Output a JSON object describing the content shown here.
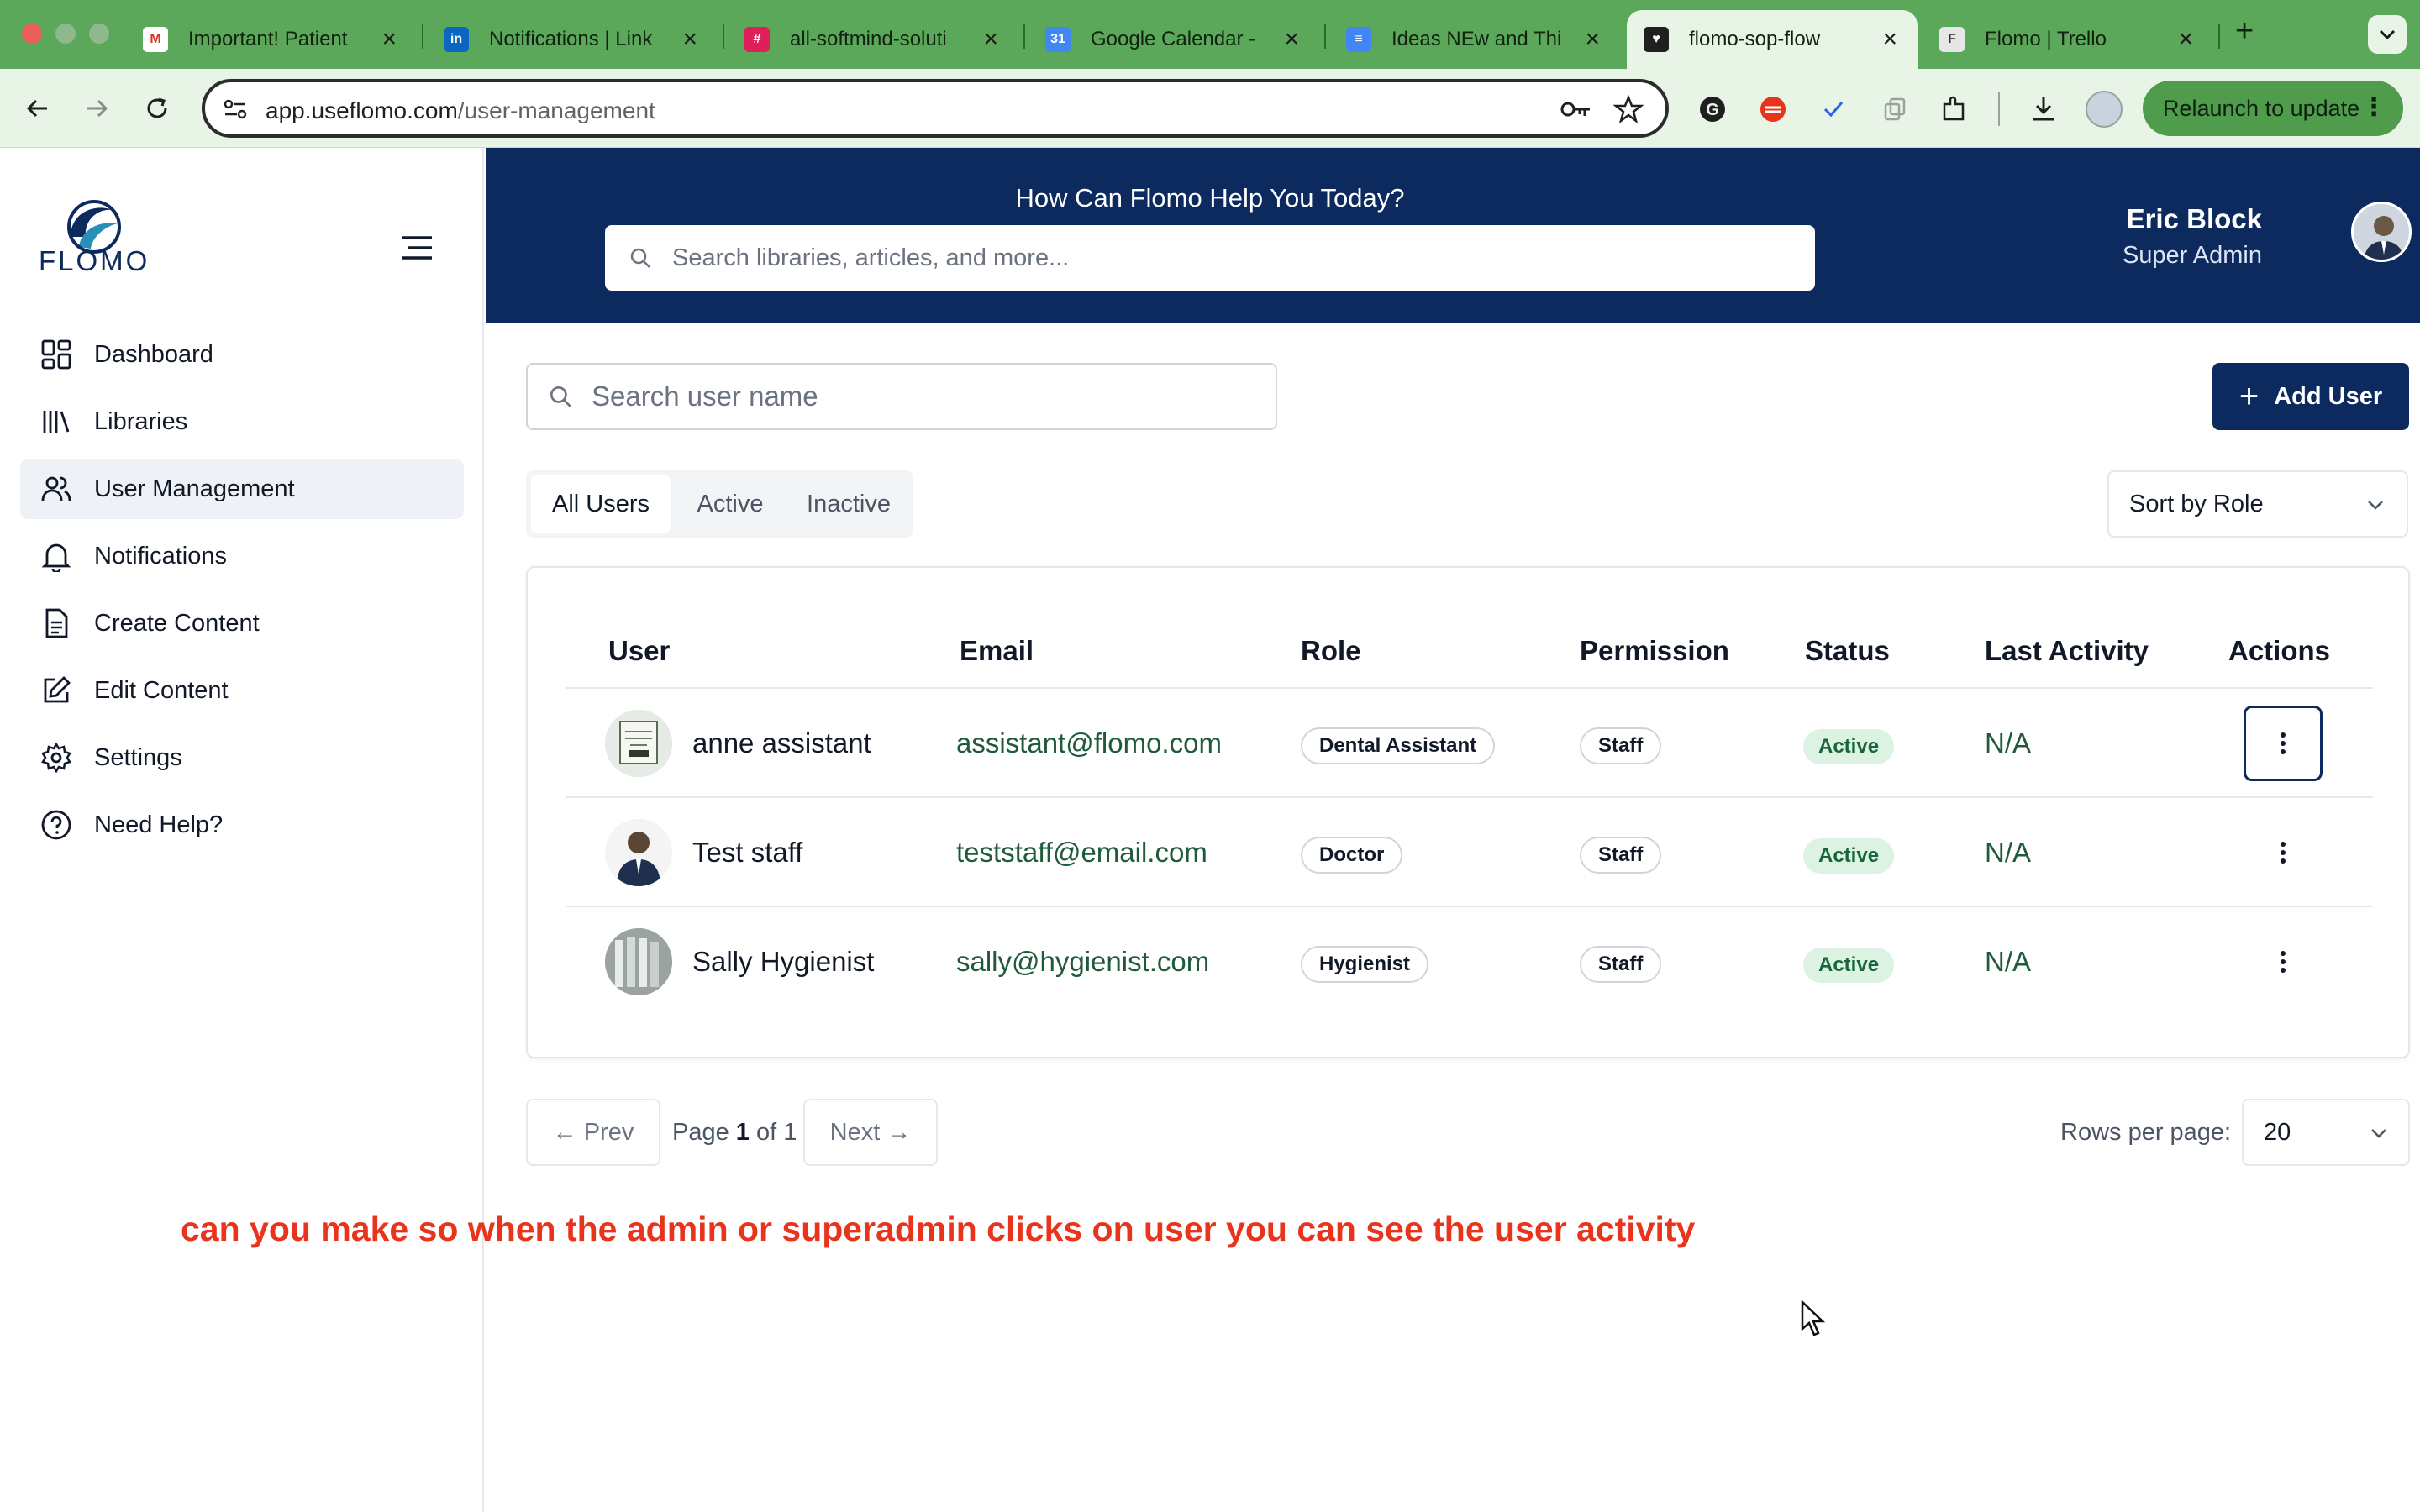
{
  "browser": {
    "tabs": [
      {
        "title": "Important! Patient",
        "favicon": "gmail-icon"
      },
      {
        "title": "Notifications | Link",
        "favicon": "linkedin-icon"
      },
      {
        "title": "all-softmind-soluti",
        "favicon": "slack-icon"
      },
      {
        "title": "Google Calendar -",
        "favicon": "calendar-icon"
      },
      {
        "title": "Ideas NEw and Thi",
        "favicon": "docs-icon"
      },
      {
        "title": "flomo-sop-flow",
        "favicon": "heart-icon",
        "active": true
      },
      {
        "title": "Flomo | Trello",
        "favicon": "trello-icon"
      }
    ],
    "url_host": "app.useflomo.com",
    "url_path": "/user-management",
    "relaunch_label": "Relaunch to update",
    "theme_color": "#5ca85a"
  },
  "sidebar": {
    "logo_text": "FLOMO",
    "items": [
      {
        "label": "Dashboard",
        "icon": "dashboard-icon"
      },
      {
        "label": "Libraries",
        "icon": "libraries-icon"
      },
      {
        "label": "User Management",
        "icon": "users-icon",
        "active": true
      },
      {
        "label": "Notifications",
        "icon": "bell-icon"
      },
      {
        "label": "Create Content",
        "icon": "document-icon"
      },
      {
        "label": "Edit Content",
        "icon": "edit-icon"
      },
      {
        "label": "Settings",
        "icon": "gear-icon"
      },
      {
        "label": "Need Help?",
        "icon": "help-icon"
      }
    ]
  },
  "header": {
    "title": "How Can Flomo Help You Today?",
    "search_placeholder": "Search libraries, articles, and more...",
    "user_name": "Eric Block",
    "user_role": "Super Admin",
    "brand_color": "#0c2a5e"
  },
  "main": {
    "search_placeholder": "Search user name",
    "add_user_label": "Add User",
    "filter_tabs": [
      {
        "label": "All Users",
        "active": true
      },
      {
        "label": "Active"
      },
      {
        "label": "Inactive"
      }
    ],
    "sort_label": "Sort by Role",
    "table": {
      "columns": [
        "User",
        "Email",
        "Role",
        "Permission",
        "Status",
        "Last Activity",
        "Actions"
      ],
      "rows": [
        {
          "name": "anne assistant",
          "email": "assistant@flomo.com",
          "role": "Dental Assistant",
          "permission": "Staff",
          "status": "Active",
          "last_activity": "N/A"
        },
        {
          "name": "Test staff",
          "email": "teststaff@email.com",
          "role": "Doctor",
          "permission": "Staff",
          "status": "Active",
          "last_activity": "N/A"
        },
        {
          "name": "Sally Hygienist",
          "email": "sally@hygienist.com",
          "role": "Hygienist",
          "permission": "Staff",
          "status": "Active",
          "last_activity": "N/A"
        }
      ]
    },
    "pagination": {
      "prev_label": "← Prev",
      "next_label": "Next →",
      "page_prefix": "Page",
      "current_page": "1",
      "page_of": "of 1",
      "rows_per_page_label": "Rows per page:",
      "rows_per_page_value": "20"
    }
  },
  "annotation": {
    "text": "can you make so when the admin or superadmin clicks on user you can see the user activity",
    "color": "#e8341c"
  }
}
